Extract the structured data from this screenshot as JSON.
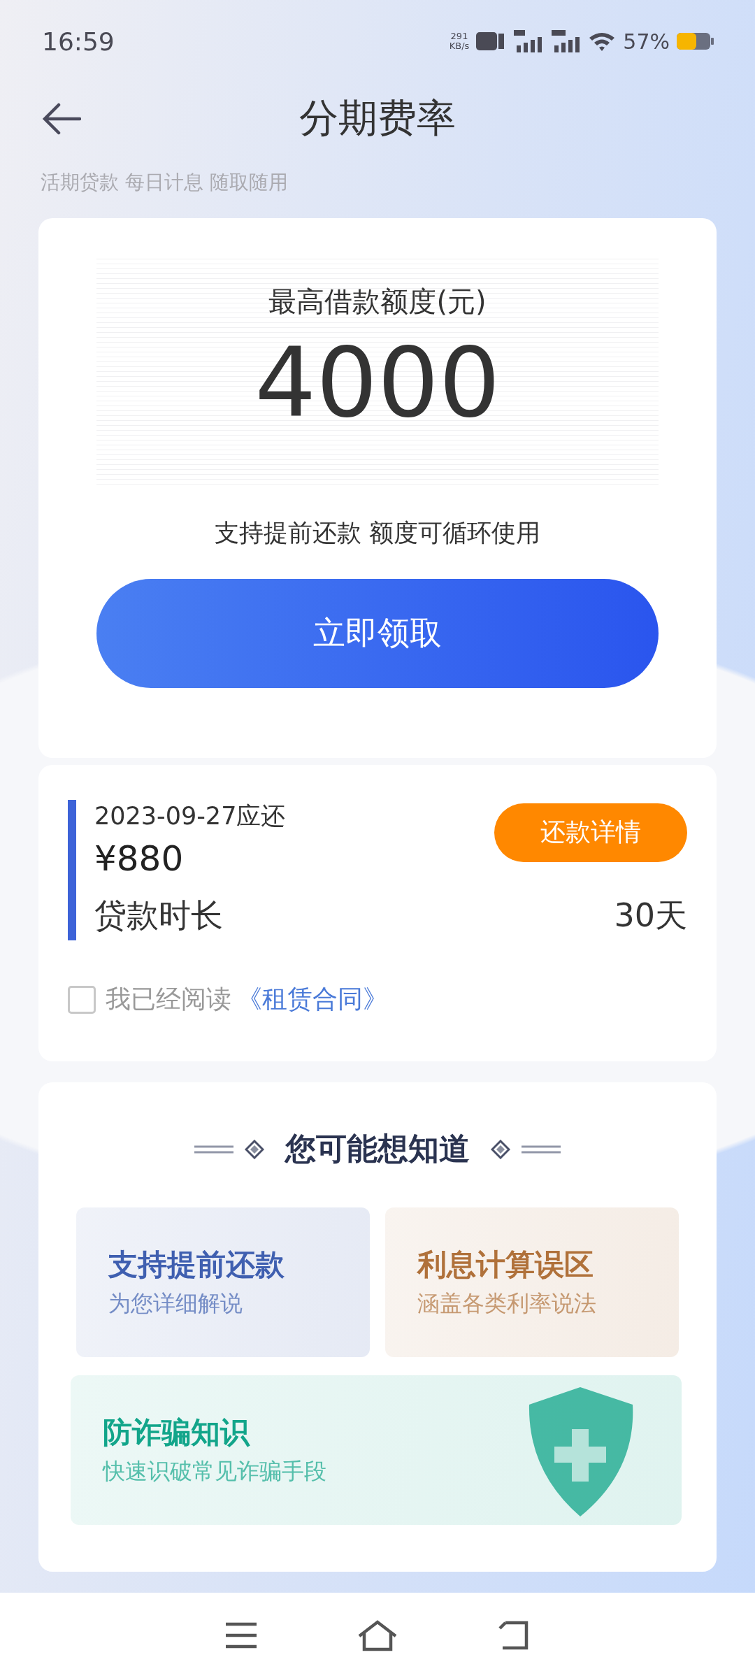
{
  "status_bar": {
    "time": "16:59",
    "speed": "291",
    "speed_unit": "KB/s",
    "battery": "57%"
  },
  "header": {
    "title": "分期费率",
    "subtitle": "活期贷款 每日计息 随取随用"
  },
  "limit_card": {
    "label": "最高借款额度(元)",
    "amount": "4000",
    "note": "支持提前还款 额度可循环使用",
    "button": "立即领取"
  },
  "repayment": {
    "due": "2023-09-27应还",
    "amount": "¥880",
    "button": "还款详情",
    "term_label": "贷款时长",
    "term_value": "30天"
  },
  "agreement": {
    "checked": false,
    "text": "我已经阅读",
    "link": "《租赁合同》"
  },
  "faq": {
    "title": "您可能想知道",
    "tiles": [
      {
        "kind": "half",
        "color": "#3f5fb0",
        "title": "支持提前还款",
        "subtitle": "为您详细解说"
      },
      {
        "kind": "half",
        "color": "#b0713a",
        "title": "利息计算误区",
        "subtitle": "涵盖各类利率说法"
      },
      {
        "kind": "wide",
        "color": "#12a58a",
        "title": "防诈骗知识",
        "subtitle": "快速识破常见诈骗手段"
      }
    ]
  }
}
